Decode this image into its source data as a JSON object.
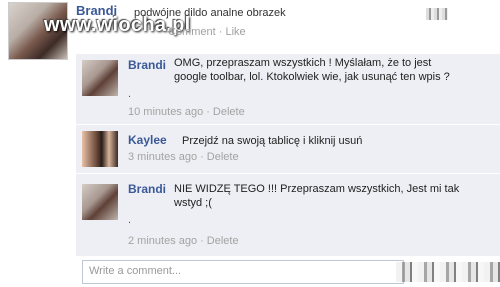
{
  "post": {
    "author": "Brandi",
    "text": "podwójne dildo analne obrazek",
    "meta_comment": "Comment",
    "meta_like": "Like",
    "meta_separator": "·"
  },
  "watermark": "www.wiocha.pl",
  "comments": [
    {
      "author": "Brandi",
      "text_line1": "OMG, przepraszam wszystkich !  Myślałam, że to jest",
      "text_line2": "google toolbar, lol. Ktokolwiek wie, jak usunąć ten wpis ?",
      "dot": ".",
      "time": "10 minutes ago",
      "delete": "Delete",
      "separator": "·"
    },
    {
      "author": "Kaylee",
      "text_line1": "Przejdź na swoją tablicę i kliknij usuń",
      "time": "3 minutes ago",
      "delete": "Delete",
      "separator": "·"
    },
    {
      "author": "Brandi",
      "text_line1": "NIE WIDZĘ TEGO !!! Przepraszam wszystkich, Jest mi tak",
      "text_line2": "wstyd ;(",
      "dot": ".",
      "time": "2 minutes ago",
      "delete": "Delete",
      "separator": "·"
    }
  ],
  "composer": {
    "placeholder": "Write a comment..."
  }
}
